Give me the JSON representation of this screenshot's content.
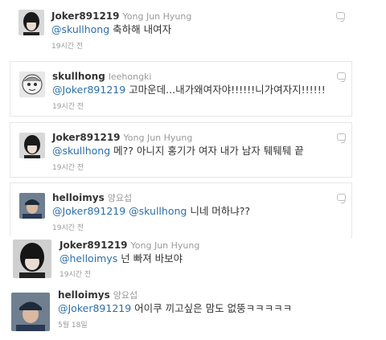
{
  "tweets": [
    {
      "screen_name": "Joker891219",
      "real_name": "Yong Jun Hyung",
      "mention": "@skullhong",
      "text": " 축하해 내여자",
      "time": "19시간 전",
      "avatar_icon": "user-photo-dark-hair"
    },
    {
      "screen_name": "skullhong",
      "real_name": "leehongki",
      "mention": "@Joker891219",
      "text": " 고마운데...내가왜여자야!!!!!!니가여자지!!!!!!",
      "time": "19시간 전",
      "avatar_icon": "user-cartoon-face"
    },
    {
      "screen_name": "Joker891219",
      "real_name": "Yong Jun Hyung",
      "mention": "@skullhong",
      "text": " 메?? 아니지 홍기가 여자 내가 남자 퉤퉤퉤 끝",
      "time": "19시간 전",
      "avatar_icon": "user-photo-dark-hair"
    },
    {
      "screen_name": "helloimys",
      "real_name": "양요섭",
      "mention": "@Joker891219",
      "mention2": "@skullhong",
      "text": " 니네 머하냐??",
      "time": "19시간 전",
      "avatar_icon": "user-photo-cap"
    },
    {
      "screen_name": "Joker891219",
      "real_name": "Yong Jun Hyung",
      "mention": "@helloimys",
      "text": " 넌 빠져 바보야",
      "time": "19시간 전",
      "avatar_icon": "user-photo-dark-hair"
    },
    {
      "screen_name": "helloimys",
      "real_name": "양요섭",
      "mention": "@Joker891219",
      "text": " 어이쿠 끼고싶은 맘도 없뚱ㅋㅋㅋㅋㅋ",
      "time": "5월 18일",
      "avatar_icon": "user-photo-cap"
    }
  ],
  "colors": {
    "mention": "#2c6fa8",
    "screen_name": "#333333",
    "meta": "#999999"
  }
}
